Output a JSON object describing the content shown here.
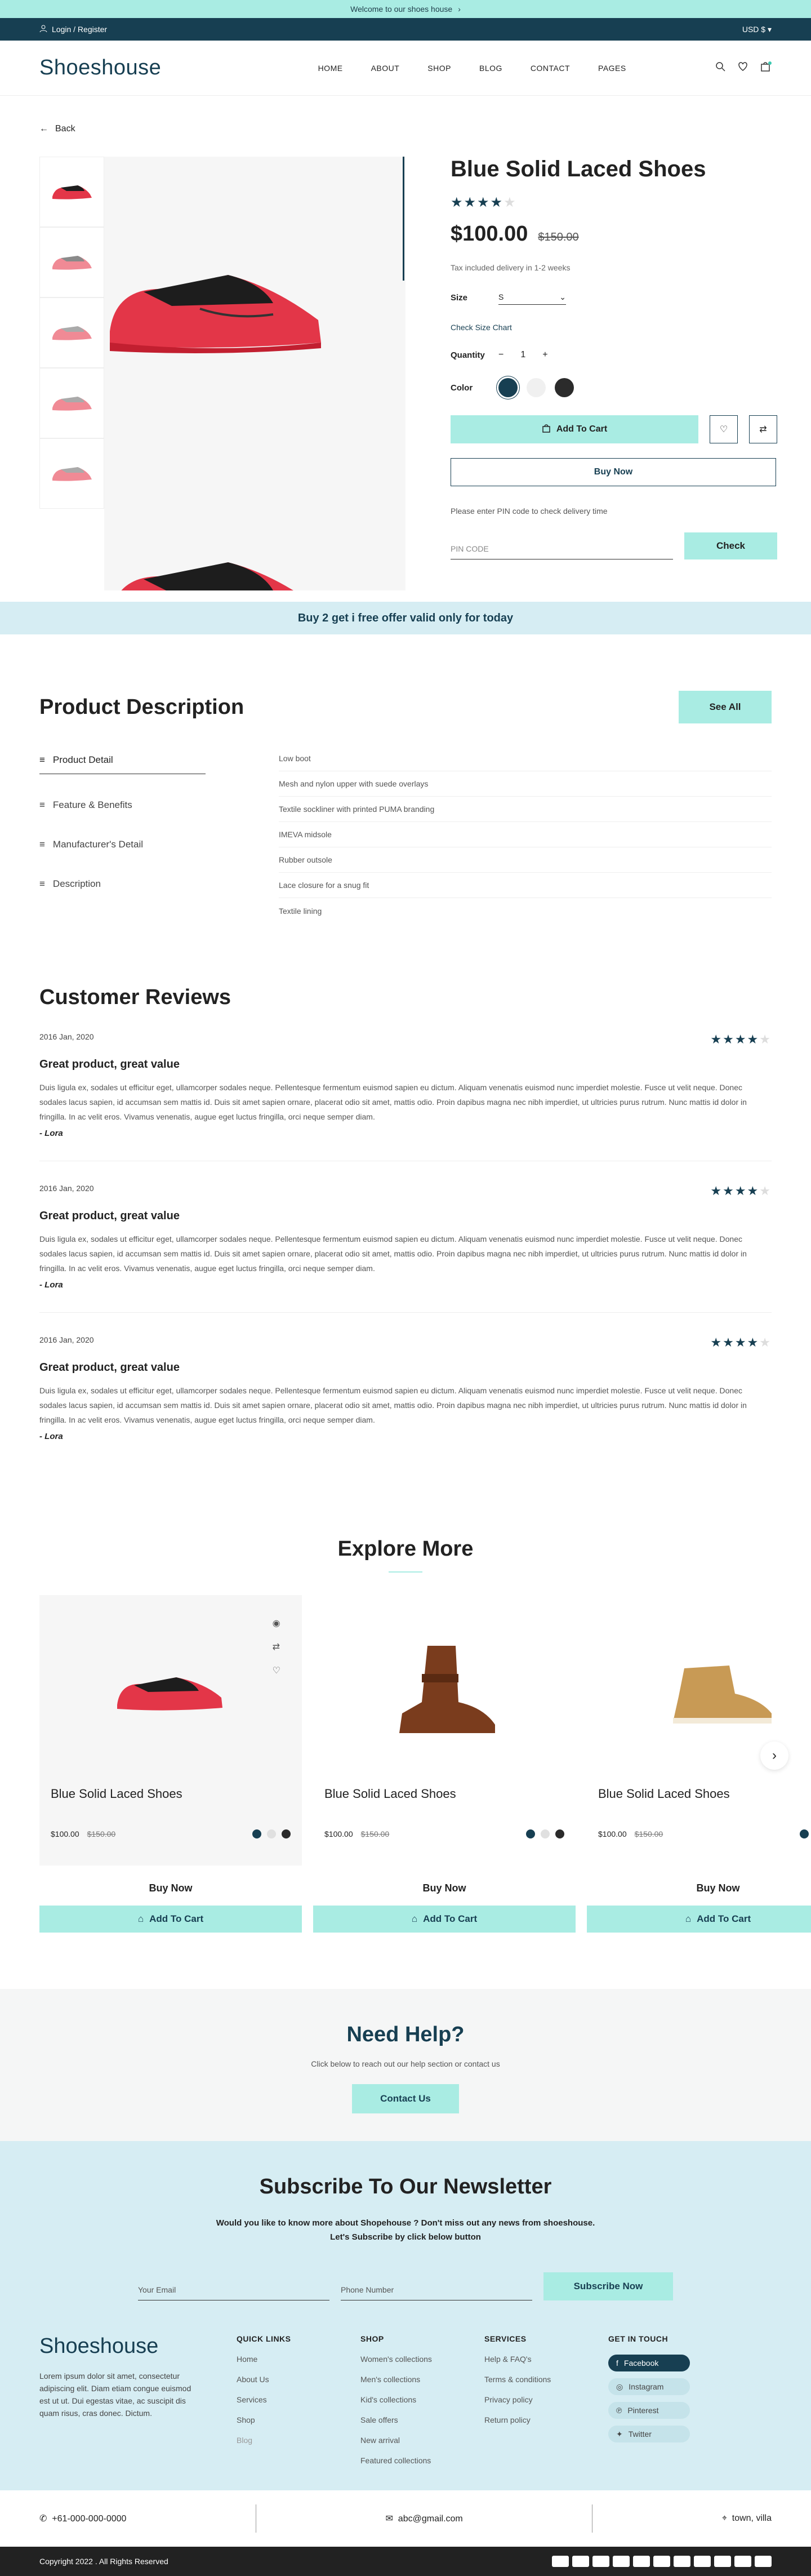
{
  "announcement": {
    "text": "Welcome to our shoes house"
  },
  "topbar": {
    "login": "Login / Register",
    "currency": "USD $"
  },
  "header": {
    "logo": "Shoeshouse",
    "nav": [
      "HOME",
      "ABOUT",
      "SHOP",
      "BLOG",
      "CONTACT",
      "PAGES"
    ]
  },
  "back": {
    "label": "Back"
  },
  "product": {
    "title": "Blue Solid Laced Shoes",
    "rating": 4,
    "price": "$100.00",
    "old_price": "$150.00",
    "tax_note": "Tax included delivery in 1-2 weeks",
    "size_label": "Size",
    "size_value": "S",
    "size_chart": "Check Size Chart",
    "qty_label": "Quantity",
    "qty_value": "1",
    "color_label": "Color",
    "colors": [
      "#173f52",
      "#f0f0f0",
      "#2b2b2b"
    ],
    "add_to_cart": "Add To Cart",
    "buy_now": "Buy Now",
    "pin_hint": "Please enter PIN code to check delivery time",
    "pin_placeholder": "PIN CODE",
    "check": "Check"
  },
  "offer": {
    "text": "Buy 2 get i free offer valid only for today"
  },
  "description": {
    "title": "Product Description",
    "see_all": "See All",
    "tabs": [
      "Product Detail",
      "Feature & Benefits",
      "Manufacturer's Detail",
      "Description"
    ],
    "items": [
      "Low boot",
      "Mesh and nylon upper with suede overlays",
      "Textile sockliner with printed PUMA branding",
      "IMEVA midsole",
      "Rubber outsole",
      "Lace closure for a snug fit",
      "Textile lining"
    ]
  },
  "reviews": {
    "title": "Customer Reviews",
    "items": [
      {
        "date": "2016 Jan, 2020",
        "rating": 4,
        "title": "Great product, great value",
        "body": "Duis ligula ex, sodales ut efficitur eget, ullamcorper sodales neque. Pellentesque fermentum euismod sapien eu dictum. Aliquam venenatis euismod nunc imperdiet molestie. Fusce ut velit neque. Donec sodales lacus sapien, id accumsan sem mattis id. Duis sit amet sapien ornare, placerat odio sit amet, mattis odio. Proin dapibus magna nec nibh imperdiet, ut ultricies purus rutrum. Nunc mattis id dolor in fringilla. In ac velit eros. Vivamus venenatis, augue eget luctus fringilla, orci neque semper diam.",
        "author": "- Lora"
      },
      {
        "date": "2016 Jan, 2020",
        "rating": 4,
        "title": "Great product, great value",
        "body": "Duis ligula ex, sodales ut efficitur eget, ullamcorper sodales neque. Pellentesque fermentum euismod sapien eu dictum. Aliquam venenatis euismod nunc imperdiet molestie. Fusce ut velit neque. Donec sodales lacus sapien, id accumsan sem mattis id. Duis sit amet sapien ornare, placerat odio sit amet, mattis odio. Proin dapibus magna nec nibh imperdiet, ut ultricies purus rutrum. Nunc mattis id dolor in fringilla. In ac velit eros. Vivamus venenatis, augue eget luctus fringilla, orci neque semper diam.",
        "author": "- Lora"
      },
      {
        "date": "2016 Jan, 2020",
        "rating": 4,
        "title": "Great product, great value",
        "body": "Duis ligula ex, sodales ut efficitur eget, ullamcorper sodales neque. Pellentesque fermentum euismod sapien eu dictum. Aliquam venenatis euismod nunc imperdiet molestie. Fusce ut velit neque. Donec sodales lacus sapien, id accumsan sem mattis id. Duis sit amet sapien ornare, placerat odio sit amet, mattis odio. Proin dapibus magna nec nibh imperdiet, ut ultricies purus rutrum. Nunc mattis id dolor in fringilla. In ac velit eros. Vivamus venenatis, augue eget luctus fringilla, orci neque semper diam.",
        "author": "- Lora"
      }
    ]
  },
  "explore": {
    "title": "Explore More",
    "cards": [
      {
        "title": "Blue Solid Laced Shoes",
        "price": "$100.00",
        "old_price": "$150.00",
        "buy": "Buy Now",
        "add": "Add To Cart"
      },
      {
        "title": "Blue Solid Laced Shoes",
        "price": "$100.00",
        "old_price": "$150.00",
        "buy": "Buy Now",
        "add": "Add To Cart"
      },
      {
        "title": "Blue Solid Laced Shoes",
        "price": "$100.00",
        "old_price": "$150.00",
        "buy": "Buy Now",
        "add": "Add To Cart"
      }
    ]
  },
  "help": {
    "title": "Need Help?",
    "text": "Click below to reach out our help section or contact us",
    "button": "Contact Us"
  },
  "newsletter": {
    "title": "Subscribe To Our Newsletter",
    "line1": "Would you like to know more about Shopehouse ? Don't miss out any news from shoeshouse.",
    "line2": "Let's Subscribe by click below button",
    "email_placeholder": "Your Email",
    "phone_placeholder": "Phone Number",
    "button": "Subscribe Now"
  },
  "footer": {
    "logo": "Shoeshouse",
    "about": "Lorem ipsum dolor sit amet, consectetur adipiscing elit. Diam etiam congue euismod est ut ut. Dui egestas vitae, ac suscipit dis quam risus, cras donec. Dictum.",
    "quick_links": {
      "title": "QUICK LINKS",
      "items": [
        "Home",
        "About Us",
        "Services",
        "Shop",
        "Blog"
      ]
    },
    "shop": {
      "title": "SHOP",
      "items": [
        "Women's collections",
        "Men's collections",
        "Kid's collections",
        "Sale offers",
        "New arrival",
        "Featured collections"
      ]
    },
    "services": {
      "title": "SERVICES",
      "items": [
        "Help & FAQ's",
        "Terms & conditions",
        "Privacy policy",
        "Return policy"
      ]
    },
    "touch": {
      "title": "GET IN TOUCH",
      "items": [
        "Facebook",
        "Instagram",
        "Pinterest",
        "Twitter"
      ]
    },
    "phone": "+61-000-000-0000",
    "email": "abc@gmail.com",
    "address": "town, villa",
    "copyright": "Copyright 2022 . All Rights Reserved"
  }
}
